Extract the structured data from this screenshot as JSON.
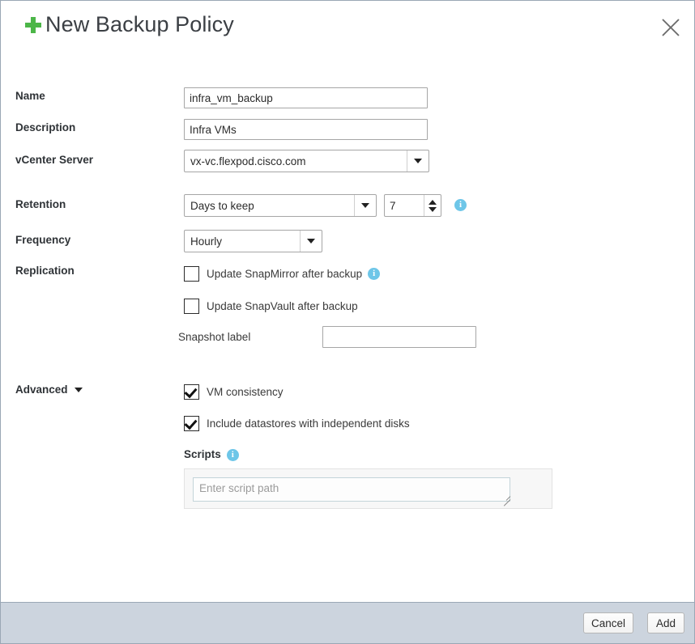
{
  "dialog": {
    "title": "New Backup Policy",
    "add_icon": "plus-icon",
    "close_icon": "close-icon"
  },
  "form": {
    "name": {
      "label": "Name",
      "value": "infra_vm_backup",
      "placeholder": ""
    },
    "description": {
      "label": "Description",
      "value": "Infra VMs",
      "placeholder": ""
    },
    "vcenter_server": {
      "label": "vCenter Server",
      "value": "vx-vc.flexpod.cisco.com",
      "options": [
        "vx-vc.flexpod.cisco.com"
      ]
    },
    "retention": {
      "label": "Retention",
      "type_value": "Days to keep",
      "options": [
        "Days to keep"
      ],
      "count": "7",
      "info_icon": "info-icon",
      "info_glyph": "i"
    },
    "frequency": {
      "label": "Frequency",
      "value": "Hourly",
      "options": [
        "Hourly"
      ]
    },
    "replication": {
      "label": "Replication",
      "snapmirror": {
        "label": "Update SnapMirror after backup",
        "checked": false,
        "info_glyph": "i"
      },
      "snapvault": {
        "label": "Update SnapVault after backup",
        "checked": false
      },
      "snapshot_label": {
        "label": "Snapshot label",
        "value": "",
        "placeholder": ""
      }
    },
    "advanced": {
      "label": "Advanced",
      "vm_consistency": {
        "label": "VM consistency",
        "checked": true
      },
      "include_datastores": {
        "label": "Include datastores with independent disks",
        "checked": true
      },
      "scripts": {
        "label": "Scripts",
        "info_glyph": "i",
        "value": "",
        "placeholder": "Enter script path"
      }
    }
  },
  "footer": {
    "cancel_label": "Cancel",
    "add_label": "Add"
  },
  "colors": {
    "accent_green": "#4cb648",
    "info_blue": "#6ec6e8",
    "footer_bar": "#ccd4de",
    "border": "#9aa7b5"
  }
}
